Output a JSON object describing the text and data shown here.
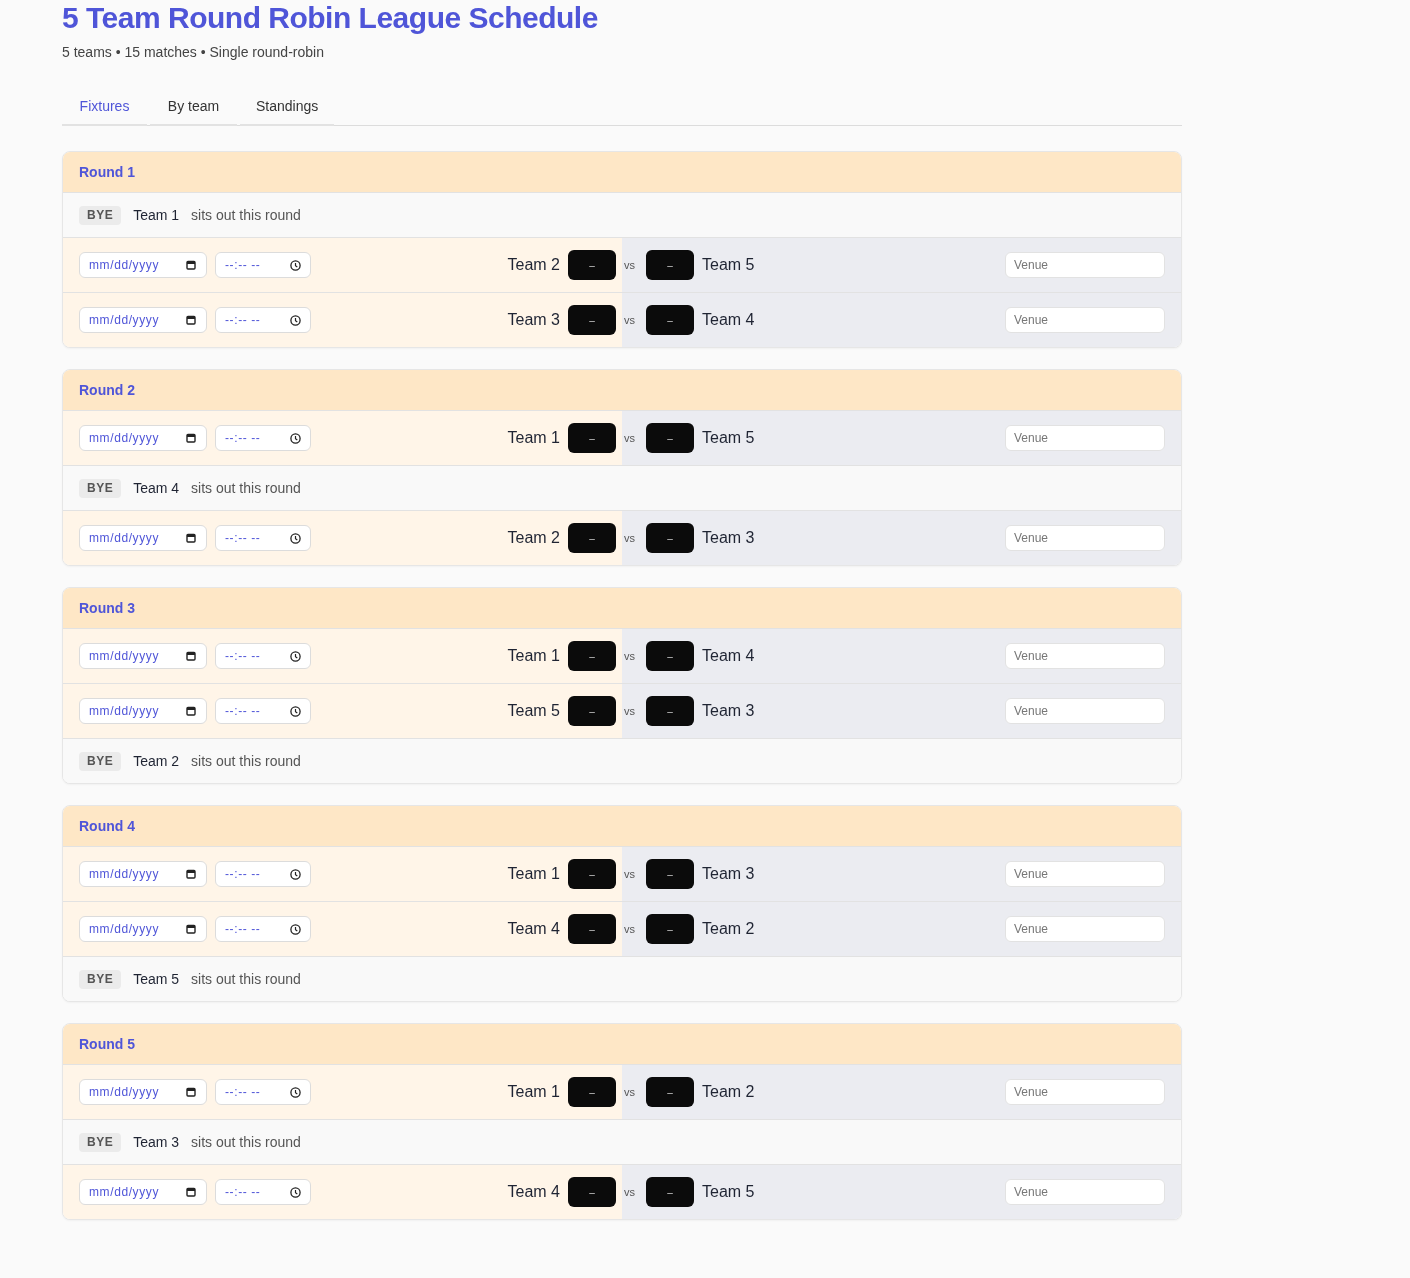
{
  "header": {
    "title": "5 Team Round Robin League Schedule",
    "subtitle": "5 teams • 15 matches • Single round-robin"
  },
  "tabs": [
    {
      "label": "Fixtures",
      "selected": true
    },
    {
      "label": "By team",
      "selected": false
    },
    {
      "label": "Standings",
      "selected": false
    }
  ],
  "rounds": [
    {
      "title": "Round 1",
      "rows": [
        {
          "kind": "bye",
          "badge": "BYE",
          "team": "Team 1",
          "note": "sits out this round"
        },
        {
          "kind": "match",
          "date": {
            "placeholder": "mm/dd/yyyy"
          },
          "time": {
            "placeholder": "--:-- --"
          },
          "home": "Team 2",
          "home_score": {
            "placeholder": "–"
          },
          "vs": "vs",
          "away_score": {
            "placeholder": "–"
          },
          "away": "Team 5",
          "venue": {
            "placeholder": "Venue"
          }
        },
        {
          "kind": "match",
          "date": {
            "placeholder": "mm/dd/yyyy"
          },
          "time": {
            "placeholder": "--:-- --"
          },
          "home": "Team 3",
          "home_score": {
            "placeholder": "–"
          },
          "vs": "vs",
          "away_score": {
            "placeholder": "–"
          },
          "away": "Team 4",
          "venue": {
            "placeholder": "Venue"
          }
        }
      ]
    },
    {
      "title": "Round 2",
      "rows": [
        {
          "kind": "match",
          "date": {
            "placeholder": "mm/dd/yyyy"
          },
          "time": {
            "placeholder": "--:-- --"
          },
          "home": "Team 1",
          "home_score": {
            "placeholder": "–"
          },
          "vs": "vs",
          "away_score": {
            "placeholder": "–"
          },
          "away": "Team 5",
          "venue": {
            "placeholder": "Venue"
          }
        },
        {
          "kind": "bye",
          "badge": "BYE",
          "team": "Team 4",
          "note": "sits out this round"
        },
        {
          "kind": "match",
          "date": {
            "placeholder": "mm/dd/yyyy"
          },
          "time": {
            "placeholder": "--:-- --"
          },
          "home": "Team 2",
          "home_score": {
            "placeholder": "–"
          },
          "vs": "vs",
          "away_score": {
            "placeholder": "–"
          },
          "away": "Team 3",
          "venue": {
            "placeholder": "Venue"
          }
        }
      ]
    },
    {
      "title": "Round 3",
      "rows": [
        {
          "kind": "match",
          "date": {
            "placeholder": "mm/dd/yyyy"
          },
          "time": {
            "placeholder": "--:-- --"
          },
          "home": "Team 1",
          "home_score": {
            "placeholder": "–"
          },
          "vs": "vs",
          "away_score": {
            "placeholder": "–"
          },
          "away": "Team 4",
          "venue": {
            "placeholder": "Venue"
          }
        },
        {
          "kind": "match",
          "date": {
            "placeholder": "mm/dd/yyyy"
          },
          "time": {
            "placeholder": "--:-- --"
          },
          "home": "Team 5",
          "home_score": {
            "placeholder": "–"
          },
          "vs": "vs",
          "away_score": {
            "placeholder": "–"
          },
          "away": "Team 3",
          "venue": {
            "placeholder": "Venue"
          }
        },
        {
          "kind": "bye",
          "badge": "BYE",
          "team": "Team 2",
          "note": "sits out this round"
        }
      ]
    },
    {
      "title": "Round 4",
      "rows": [
        {
          "kind": "match",
          "date": {
            "placeholder": "mm/dd/yyyy"
          },
          "time": {
            "placeholder": "--:-- --"
          },
          "home": "Team 1",
          "home_score": {
            "placeholder": "–"
          },
          "vs": "vs",
          "away_score": {
            "placeholder": "–"
          },
          "away": "Team 3",
          "venue": {
            "placeholder": "Venue"
          }
        },
        {
          "kind": "match",
          "date": {
            "placeholder": "mm/dd/yyyy"
          },
          "time": {
            "placeholder": "--:-- --"
          },
          "home": "Team 4",
          "home_score": {
            "placeholder": "–"
          },
          "vs": "vs",
          "away_score": {
            "placeholder": "–"
          },
          "away": "Team 2",
          "venue": {
            "placeholder": "Venue"
          }
        },
        {
          "kind": "bye",
          "badge": "BYE",
          "team": "Team 5",
          "note": "sits out this round"
        }
      ]
    },
    {
      "title": "Round 5",
      "rows": [
        {
          "kind": "match",
          "date": {
            "placeholder": "mm/dd/yyyy"
          },
          "time": {
            "placeholder": "--:-- --"
          },
          "home": "Team 1",
          "home_score": {
            "placeholder": "–"
          },
          "vs": "vs",
          "away_score": {
            "placeholder": "–"
          },
          "away": "Team 2",
          "venue": {
            "placeholder": "Venue"
          }
        },
        {
          "kind": "bye",
          "badge": "BYE",
          "team": "Team 3",
          "note": "sits out this round"
        },
        {
          "kind": "match",
          "date": {
            "placeholder": "mm/dd/yyyy"
          },
          "time": {
            "placeholder": "--:-- --"
          },
          "home": "Team 4",
          "home_score": {
            "placeholder": "–"
          },
          "vs": "vs",
          "away_score": {
            "placeholder": "–"
          },
          "away": "Team 5",
          "venue": {
            "placeholder": "Venue"
          }
        }
      ]
    }
  ]
}
